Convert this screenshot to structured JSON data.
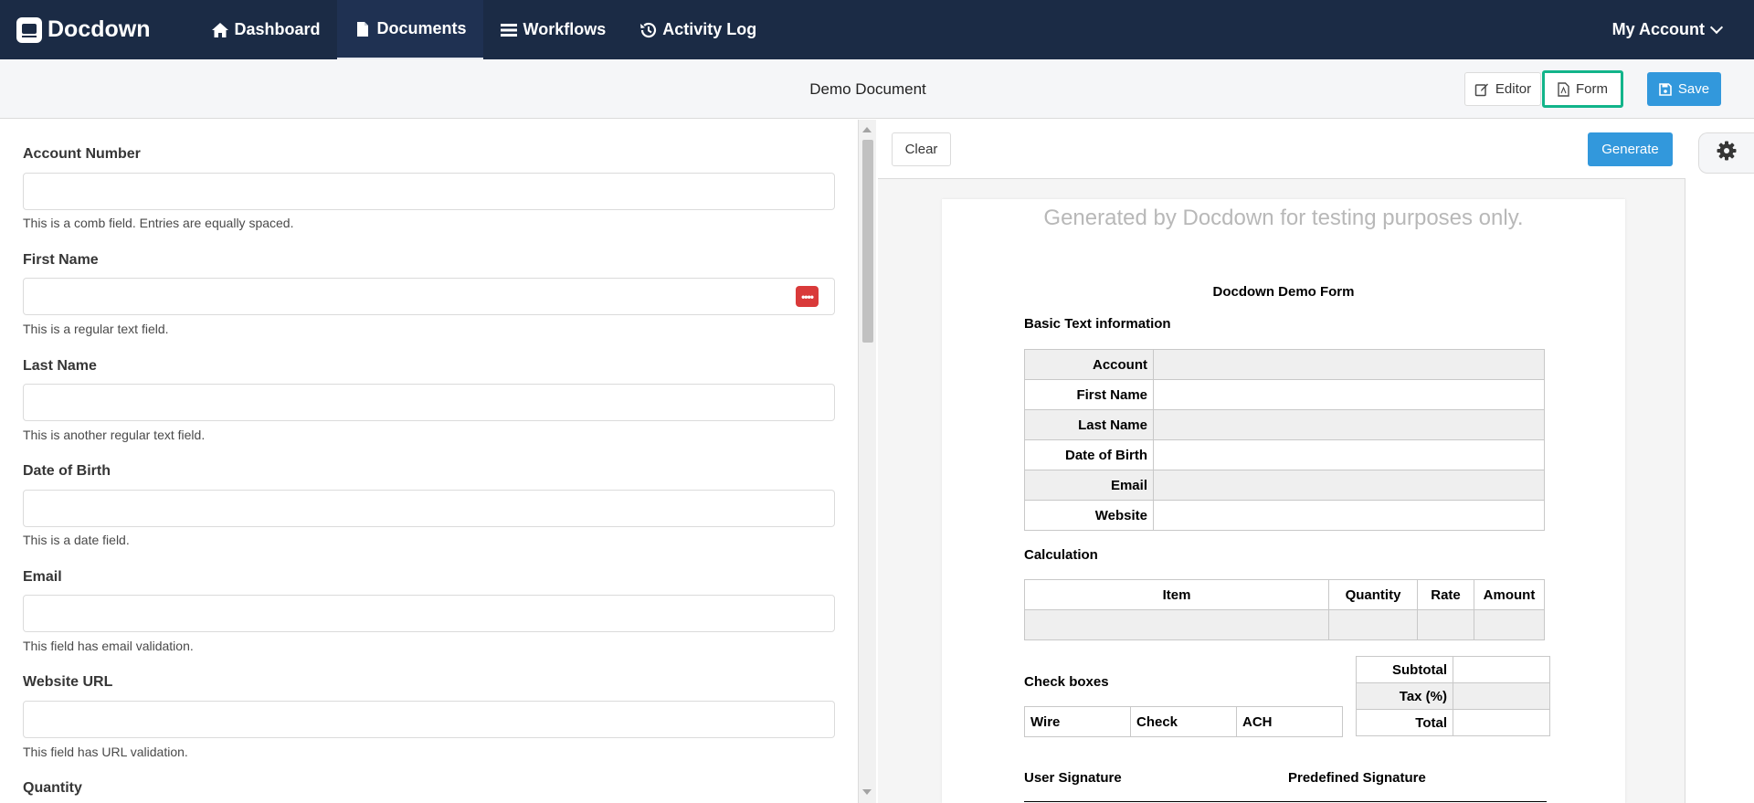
{
  "brand": {
    "name": "Docdown"
  },
  "nav": {
    "items": [
      {
        "label": "Dashboard",
        "icon": "home-icon"
      },
      {
        "label": "Documents",
        "icon": "file-icon"
      },
      {
        "label": "Workflows",
        "icon": "bars-icon"
      },
      {
        "label": "Activity Log",
        "icon": "history-icon"
      }
    ],
    "account_label": "My Account"
  },
  "document": {
    "title": "Demo Document",
    "editor_label": "Editor",
    "form_label": "Form",
    "save_label": "Save"
  },
  "form": {
    "fields": [
      {
        "label": "Account Number",
        "help": "This is a comb field. Entries are equally spaced.",
        "value": ""
      },
      {
        "label": "First Name",
        "help": "This is a regular text field.",
        "value": ""
      },
      {
        "label": "Last Name",
        "help": "This is another regular text field.",
        "value": ""
      },
      {
        "label": "Date of Birth",
        "help": "This is a date field.",
        "value": ""
      },
      {
        "label": "Email",
        "help": "This field has email validation.",
        "value": ""
      },
      {
        "label": "Website URL",
        "help": "This field has URL validation.",
        "value": ""
      },
      {
        "label": "Quantity"
      }
    ],
    "password_manager_badge": "••••"
  },
  "preview": {
    "clear_label": "Clear",
    "generate_label": "Generate",
    "watermark": "Generated by Docdown for testing purposes only.",
    "form_title": "Docdown Demo Form",
    "basic_heading": "Basic Text information",
    "basic_rows": [
      "Account",
      "First Name",
      "Last Name",
      "Date of Birth",
      "Email",
      "Website"
    ],
    "calc_heading": "Calculation",
    "calc_columns": [
      "Item",
      "Quantity",
      "Rate",
      "Amount"
    ],
    "totals": [
      "Subtotal",
      "Tax (%)",
      "Total"
    ],
    "checkbox_heading": "Check boxes",
    "checkboxes": [
      "Wire",
      "Check",
      "ACH"
    ],
    "user_signature": "User Signature",
    "predefined_signature": "Predefined Signature"
  },
  "colors": {
    "nav_bg": "#1b2b45",
    "primary": "#3298dc",
    "highlight": "#12b48a",
    "danger": "#d93a3a"
  }
}
